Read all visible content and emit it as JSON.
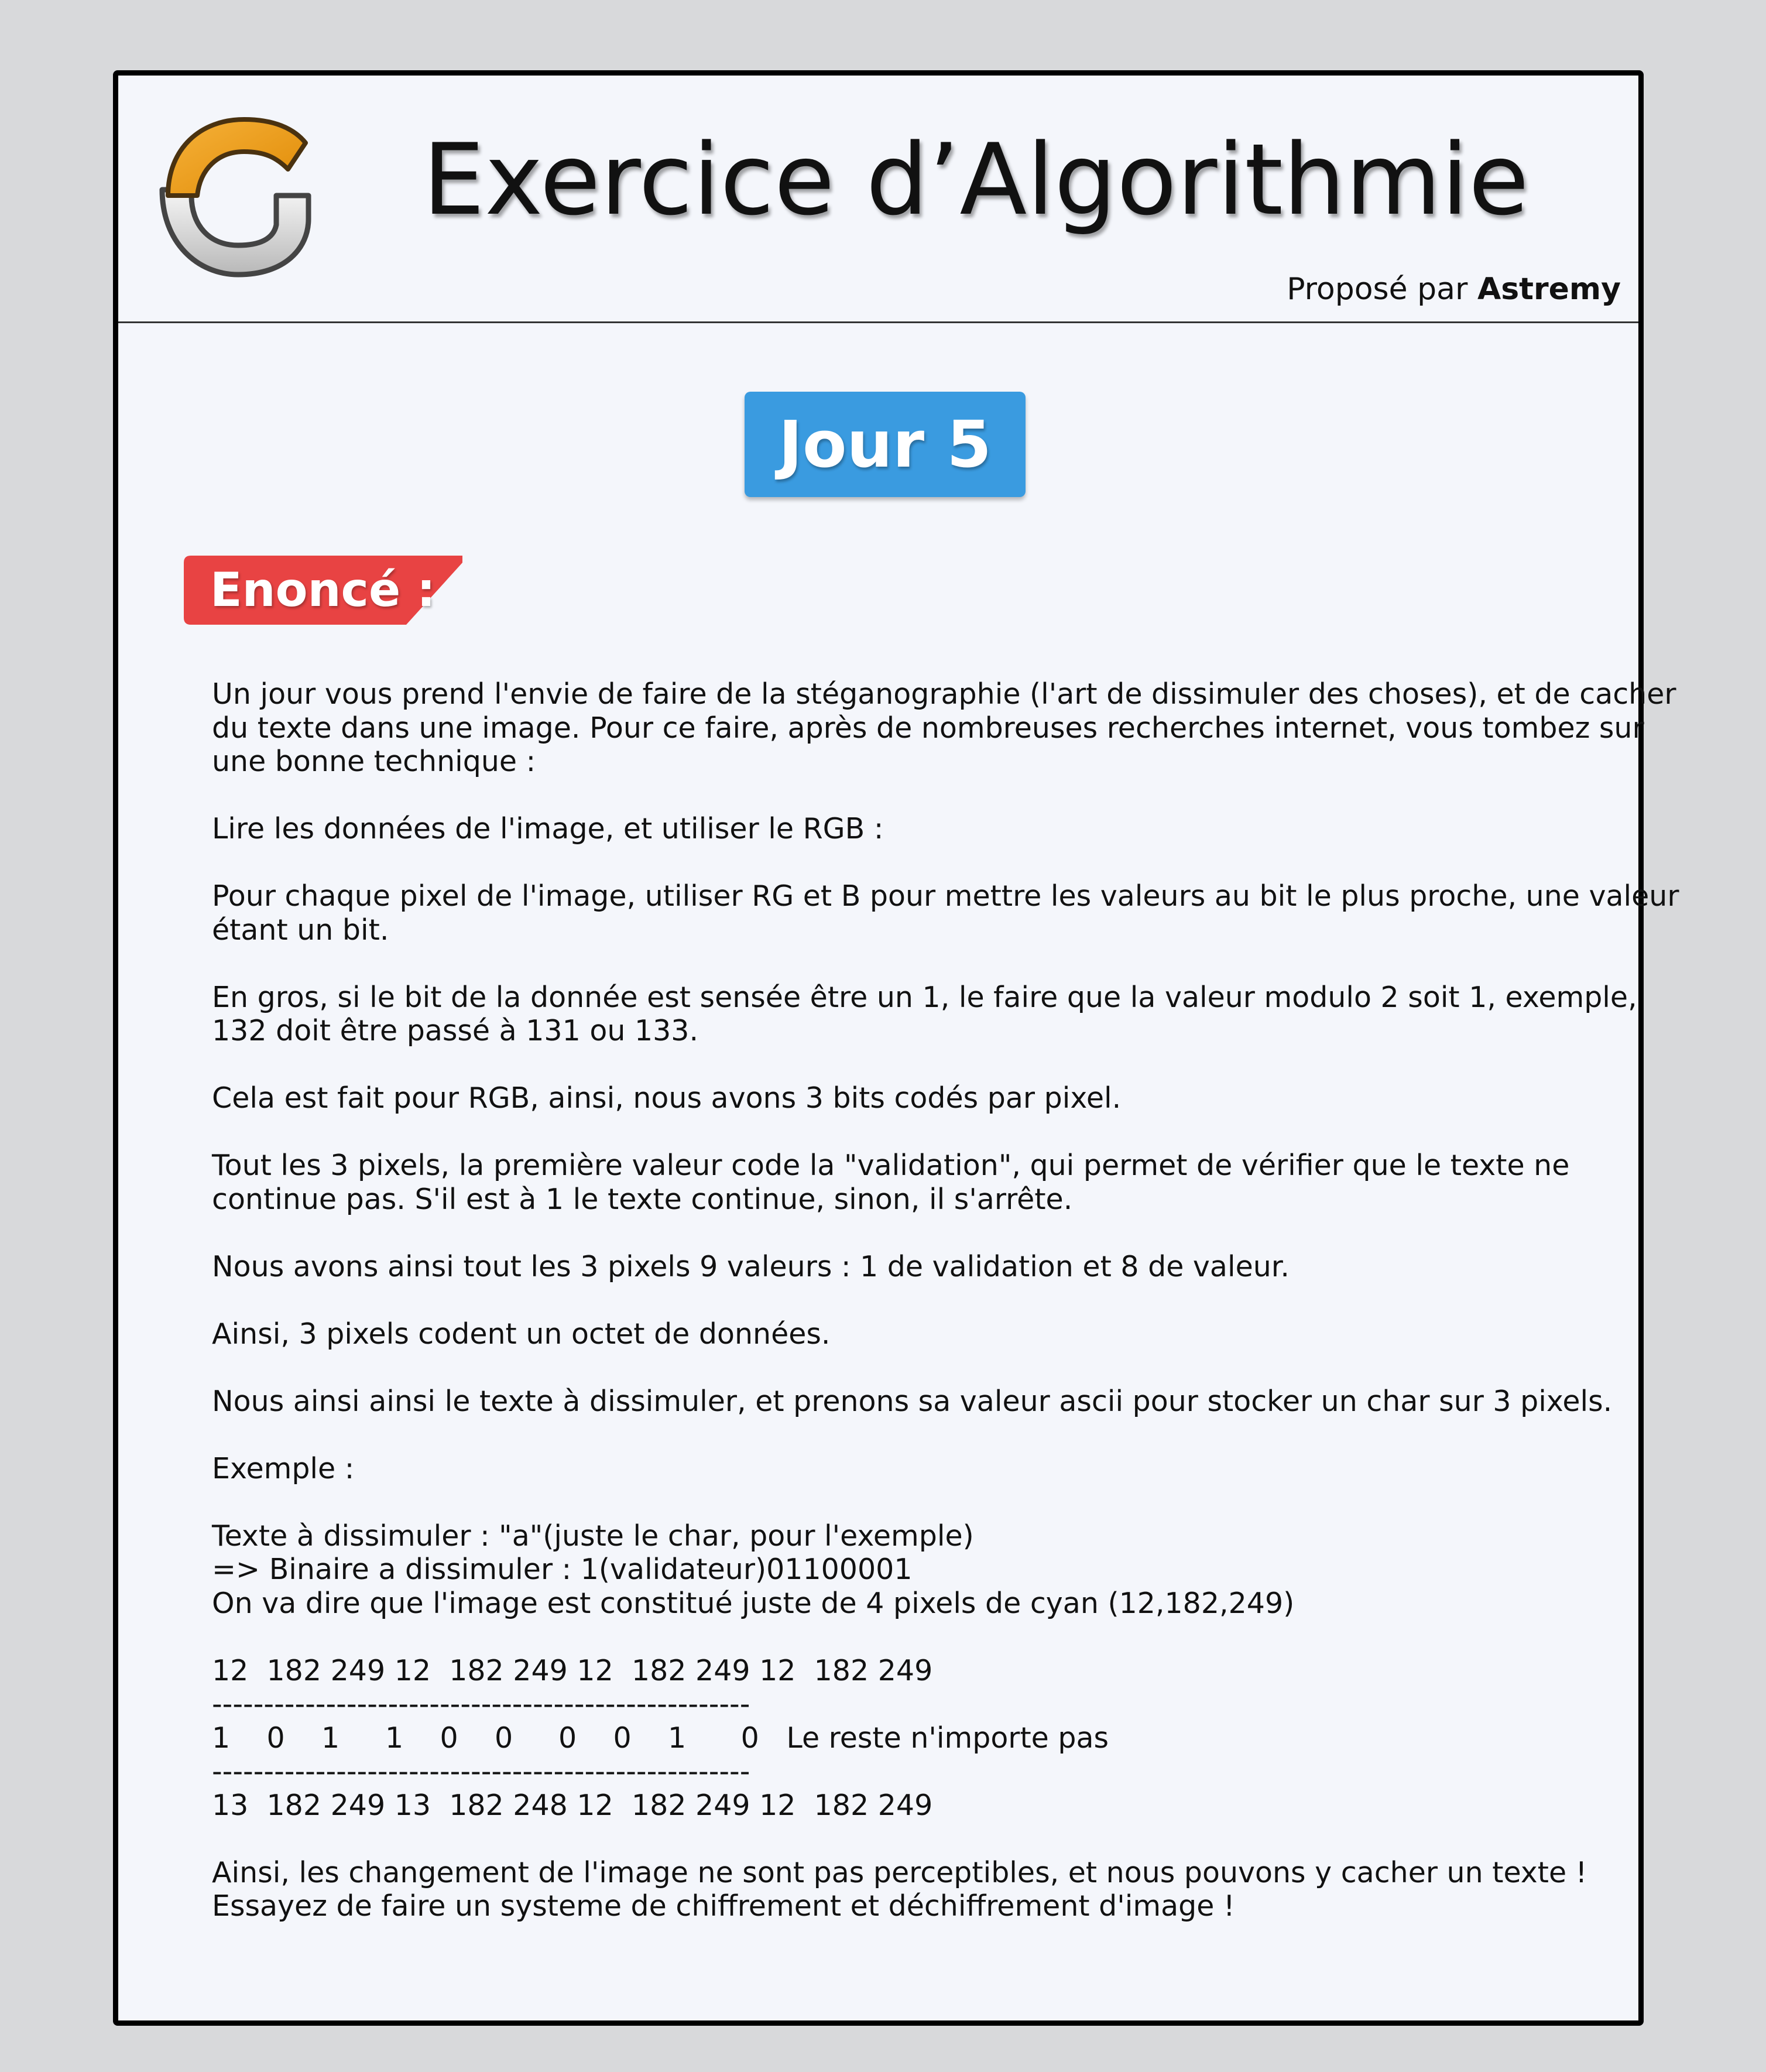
{
  "header": {
    "title": "Exercice d’Algorithmie",
    "byline_prefix": "Proposé par",
    "byline_author": "Astremy",
    "logo_icon": "g-logo-icon"
  },
  "day_badge": "Jour 5",
  "statement_tag": "Enoncé :",
  "colors": {
    "badge_blue": "#3a9be0",
    "tag_red": "#e84343",
    "logo_orange": "#f29a12",
    "page_bg": "#f4f6fb"
  },
  "content": {
    "lines": [
      "Un jour vous prend l'envie de faire de la stéganographie (l'art de dissimuler des choses), et de cacher",
      "du texte dans une image. Pour ce faire, après de nombreuses recherches internet, vous tombez sur",
      "une bonne technique :",
      "",
      "Lire les données de l'image, et utiliser le RGB :",
      "",
      "Pour chaque pixel de l'image, utiliser RG et B pour mettre les valeurs au bit le plus proche, une valeur",
      "étant un bit.",
      "",
      "En gros, si le bit de la donnée est sensée être un 1, le faire que la valeur modulo 2 soit 1, exemple,",
      "132 doit être passé à 131 ou 133.",
      "",
      "Cela est fait pour RGB, ainsi, nous avons 3 bits codés par pixel.",
      "",
      "Tout les 3 pixels, la première valeur code la \"validation\", qui permet de vérifier que le texte ne",
      "continue pas. S'il est à 1 le texte continue, sinon, il s'arrête.",
      "",
      "Nous avons ainsi tout les 3 pixels 9 valeurs : 1 de validation et 8 de valeur.",
      "",
      "Ainsi, 3 pixels codent un octet de données.",
      "",
      "Nous ainsi ainsi le texte à dissimuler, et prenons sa valeur ascii pour stocker un char sur 3 pixels.",
      "",
      "Exemple :",
      "",
      "Texte à dissimuler : \"a\"(juste le char, pour l'exemple)",
      "=> Binaire a dissimuler : 1(validateur)01100001",
      "On va dire que l'image est constitué juste de 4 pixels de cyan (12,182,249)",
      "",
      "12  182 249 12  182 249 12  182 249 12  182 249",
      "----------------------------------------------------",
      "1    0    1     1    0    0     0    0    1      0   Le reste n'importe pas",
      "----------------------------------------------------",
      "13  182 249 13  182 248 12  182 249 12  182 249",
      "",
      "Ainsi, les changement de l'image ne sont pas perceptibles, et nous pouvons y cacher un texte !",
      "Essayez de faire un systeme de chiffrement et déchiffrement d'image !"
    ]
  }
}
